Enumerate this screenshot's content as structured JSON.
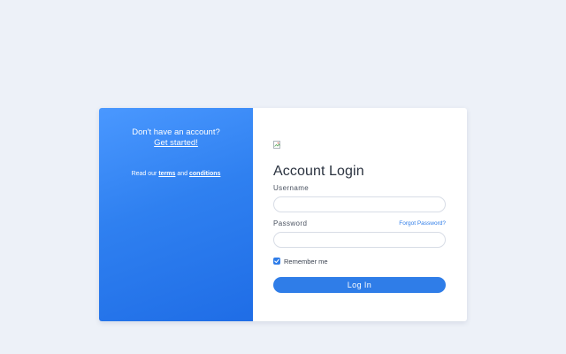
{
  "left_panel": {
    "prompt": "Don't have an account?",
    "signup_link": "Get started!",
    "terms_prefix": "Read our ",
    "terms_link": "terms",
    "terms_and": " and ",
    "conditions_link": "conditions"
  },
  "form": {
    "title": "Account Login",
    "username_label": "Username",
    "username_value": "",
    "password_label": "Password",
    "password_value": "",
    "forgot_link": "Forgot Password?",
    "remember_label": "Remember me",
    "remember_checked": true,
    "submit_label": "Log In"
  },
  "icons": {
    "logo": "broken-image-icon",
    "check": "checkmark-icon"
  },
  "colors": {
    "accent": "#2f7de8",
    "page_background": "#edf1f8"
  }
}
